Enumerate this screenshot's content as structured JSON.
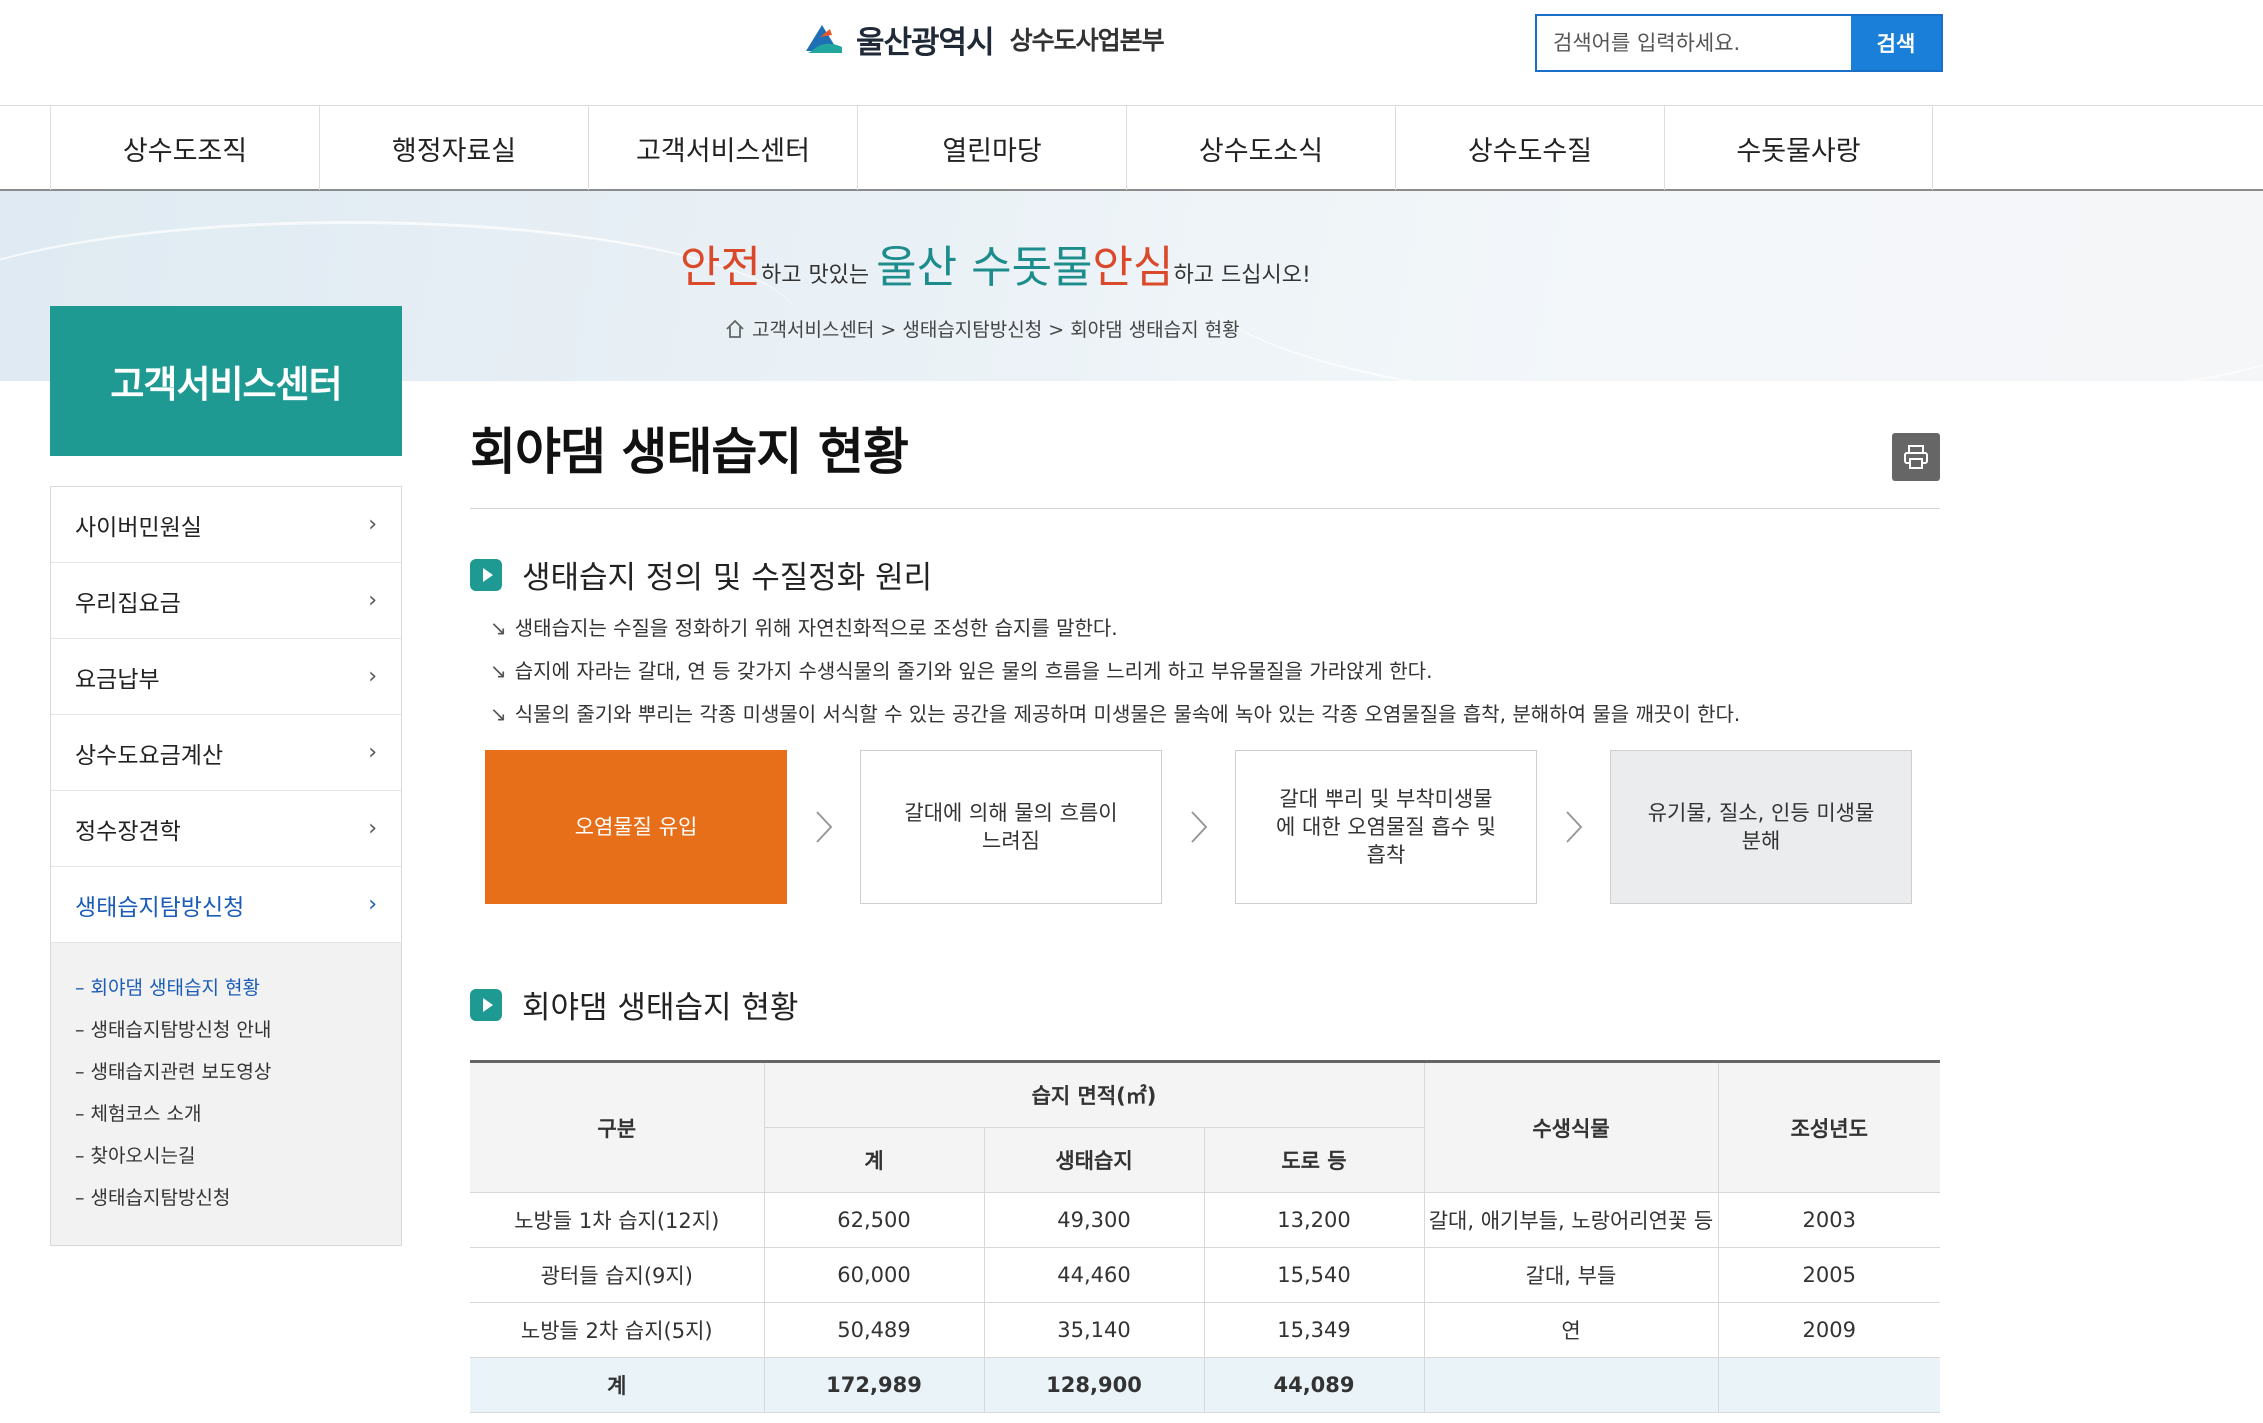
{
  "header": {
    "city": "울산광역시",
    "dept": "상수도사업본부",
    "search_placeholder": "검색어를 입력하세요.",
    "search_button": "검색"
  },
  "gnb": [
    "상수도조직",
    "행정자료실",
    "고객서비스센터",
    "열린마당",
    "상수도소식",
    "상수도수질",
    "수돗물사랑"
  ],
  "slogan": {
    "p1": "안전",
    "p2": "하고 맛있는 ",
    "p3": "울산 수돗물",
    "p4": "안심",
    "p5": "하고 드십시오!"
  },
  "breadcrumb": "고객서비스센터 > 생태습지탐방신청 > 회야댐 생태습지 현황",
  "sidebar": {
    "title": "고객서비스센터",
    "items": [
      {
        "label": "사이버민원실"
      },
      {
        "label": "우리집요금"
      },
      {
        "label": "요금납부"
      },
      {
        "label": "상수도요금계산"
      },
      {
        "label": "정수장견학"
      },
      {
        "label": "생태습지탐방신청"
      }
    ],
    "sub": [
      "회야댐 생태습지 현황",
      "생태습지탐방신청 안내",
      "생태습지관련 보도영상",
      "체험코스 소개",
      "찾아오시는길",
      "생태습지탐방신청"
    ],
    "chevron": "›",
    "sub_prefix": "–"
  },
  "main": {
    "title": "회야댐 생태습지 현황",
    "section1": {
      "heading": "생태습지 정의 및 수질정화 원리",
      "bullet": "↘",
      "lines": [
        "생태습지는 수질을 정화하기 위해 자연친화적으로 조성한 습지를 말한다.",
        "습지에 자라는 갈대, 연 등 갖가지 수생식물의 줄기와 잎은 물의 흐름을 느리게 하고 부유물질을 가라앉게 한다.",
        "식물의 줄기와 뿌리는 각종 미생물이 서식할 수 있는 공간을 제공하며 미생물은 물속에 녹아 있는 각종 오염물질을 흡착, 분해하여 물을 깨끗이 한다."
      ],
      "flow": [
        "오염물질 유입",
        "갈대에 의해 물의 흐름이 느려짐",
        "갈대 뿌리 및 부착미생물에 대한 오염물질 흡수 및 흡착",
        "유기물, 질소, 인등 미생물 분해"
      ]
    },
    "section2": {
      "heading": "회야댐 생태습지 현황",
      "table": {
        "h_gubun": "구분",
        "h_area": "습지 면적(㎡)",
        "h_total": "계",
        "h_wetland": "생태습지",
        "h_road": "도로 등",
        "h_plants": "수생식물",
        "h_year": "조성년도",
        "rows": [
          [
            "노방들 1차 습지(12지)",
            "62,500",
            "49,300",
            "13,200",
            "갈대, 애기부들, 노랑어리연꽃 등",
            "2003"
          ],
          [
            "광터들 습지(9지)",
            "60,000",
            "44,460",
            "15,540",
            "갈대, 부들",
            "2005"
          ],
          [
            "노방들 2차 습지(5지)",
            "50,489",
            "35,140",
            "15,349",
            "연",
            "2009"
          ],
          [
            "계",
            "172,989",
            "128,900",
            "44,089",
            "",
            ""
          ]
        ]
      }
    }
  },
  "colors": {
    "teal": "#1f9a92",
    "orange": "#e86f1a",
    "blue": "#1a7fd8",
    "active_link": "#1a5cb8"
  }
}
